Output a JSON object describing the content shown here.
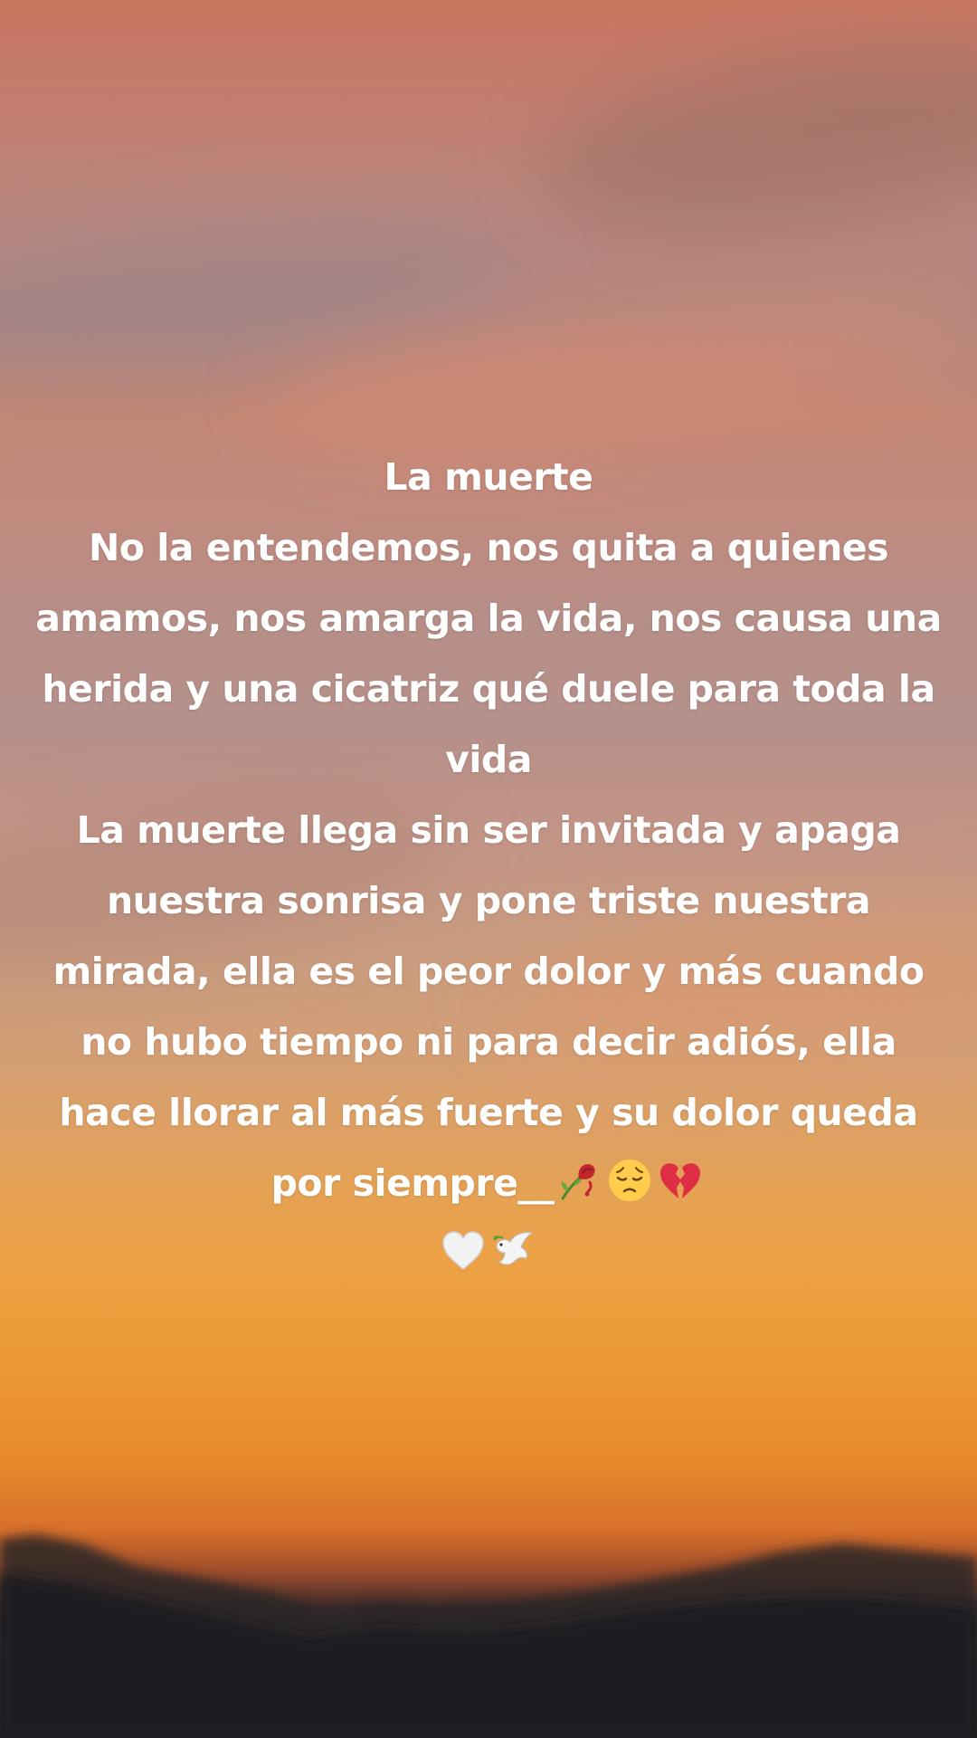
{
  "post": {
    "title": "La muerte",
    "lines": [
      "No la entendemos, nos quita a quienes",
      "amamos, nos amarga la vida, nos causa una",
      "herida y una cicatriz qué duele para toda la",
      "vida",
      "La muerte llega sin ser invitada y apaga",
      "nuestra sonrisa y pone triste nuestra",
      "mirada, ella es el peor dolor y más cuando",
      "no hubo tiempo ni para decir adiós, ella",
      "hace llorar al más fuerte y su dolor queda",
      "por siempre__"
    ],
    "emoji_line_1": [
      "wilted-rose",
      "pensive-face",
      "broken-heart"
    ],
    "emoji_line_2": [
      "white-heart",
      "dove"
    ]
  },
  "colors": {
    "text": "#ffffff",
    "sky_top": "#c97660",
    "sky_bottom": "#e78a2a",
    "mountain": "#1f1f24"
  }
}
